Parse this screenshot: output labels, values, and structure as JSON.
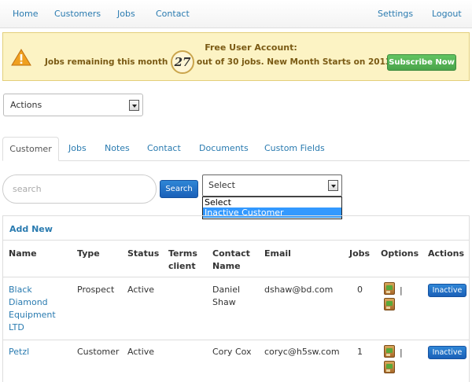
{
  "nav": {
    "left": [
      "Home",
      "Customers",
      "Jobs",
      "Contact"
    ],
    "right": [
      "Settings",
      "Logout"
    ]
  },
  "banner": {
    "title": "Free User Account:",
    "line_before": "Jobs remaining this month are",
    "count": "27",
    "line_after": "out of 30 jobs. New Month Starts on 2013-12-26.",
    "subscribe_label": "Subscribe Now",
    "icon": "warning-icon"
  },
  "actions_select": {
    "selected": "Actions"
  },
  "tabs": [
    "Customer",
    "Jobs",
    "Notes",
    "Contact",
    "Documents",
    "Custom Fields"
  ],
  "search": {
    "placeholder": "search",
    "button_label": "Search"
  },
  "status_select": {
    "selected": "Select",
    "options": [
      "Select",
      "Inactive Customer"
    ],
    "highlighted_option": "Inactive Customer"
  },
  "table": {
    "add_new_label": "Add New",
    "headers": {
      "name": "Name",
      "type": "Type",
      "status": "Status",
      "terms_1": "Terms",
      "terms_2": "client",
      "contact_1": "Contact",
      "contact_2": "Name",
      "email": "Email",
      "jobs": "Jobs",
      "options": "Options",
      "actions": "Actions"
    },
    "rows": [
      {
        "name_lines": [
          "Black",
          "Diamond",
          "Equipment",
          "LTD"
        ],
        "type": "Prospect",
        "status": "Active",
        "terms": "",
        "contact_lines": [
          "Daniel",
          "Shaw"
        ],
        "email": "dshaw@bd.com",
        "jobs": "0",
        "options_sep": "|",
        "action_label": "Inactive"
      },
      {
        "name_lines": [
          "Petzl"
        ],
        "type": "Customer",
        "status": "Active",
        "terms": "",
        "contact_lines": [
          "Cory Cox"
        ],
        "email": "coryc@h5sw.com",
        "jobs": "1",
        "options_sep": "|",
        "action_label": "Inactive"
      }
    ]
  },
  "colors": {
    "link": "#2a7bb0",
    "banner_bg": "#fcf3c4",
    "subscribe_green": "#5cb85c",
    "primary_blue": "#1f6fc5"
  }
}
